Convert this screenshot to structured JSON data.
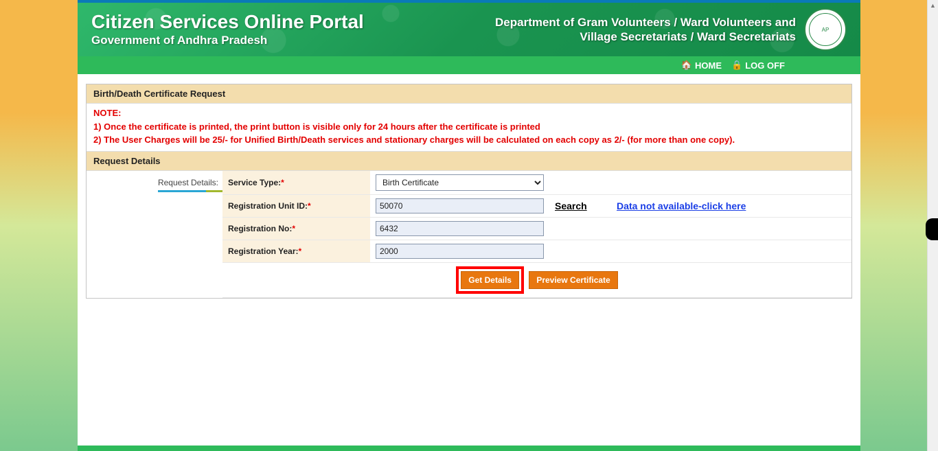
{
  "header": {
    "portal_title": "Citizen Services Online Portal",
    "portal_subtitle": "Government of Andhra Pradesh",
    "department_line1": "Department of Gram Volunteers / Ward Volunteers and",
    "department_line2": "Village Secretariats / Ward Secretariats"
  },
  "nav": {
    "home": "HOME",
    "logoff": "LOG OFF"
  },
  "panel": {
    "title": "Birth/Death Certificate Request",
    "note_heading": "NOTE:",
    "note_1": "1) Once the certificate is printed, the print button is visible only for 24 hours after the certificate is printed",
    "note_2": "2) The User Charges will be 25/- for Unified Birth/Death services and stationary charges will be calculated on each copy as 2/- (for more than one copy).",
    "section_title": "Request Details",
    "sidebar_tab": "Request Details:"
  },
  "form": {
    "service_type_label": "Service Type:",
    "service_type_value": "Birth Certificate",
    "reg_unit_label": "Registration Unit ID:",
    "reg_unit_value": "50070",
    "reg_no_label": "Registration No:",
    "reg_no_value": "6432",
    "reg_year_label": "Registration Year:",
    "reg_year_value": "2000",
    "search_link": "Search",
    "data_na_link": "Data not available-click here"
  },
  "buttons": {
    "get_details": "Get Details",
    "preview": "Preview Certificate"
  }
}
